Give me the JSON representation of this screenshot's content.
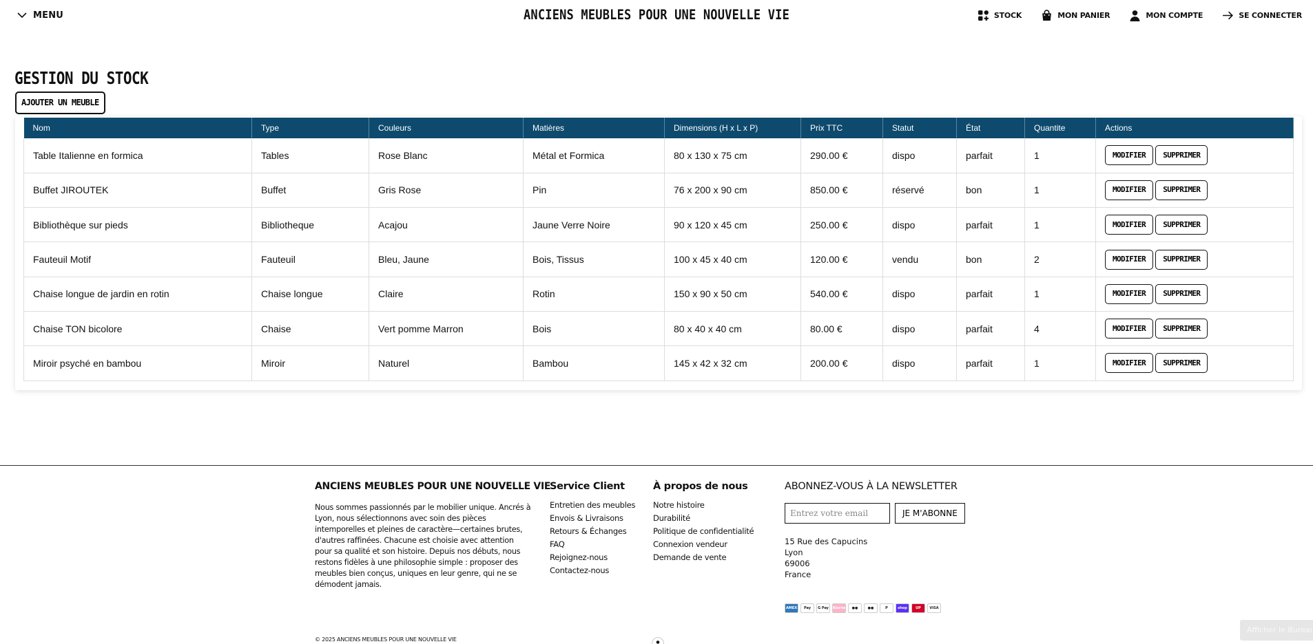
{
  "header": {
    "menu_label": "MENU",
    "site_title": "ANCIENS MEUBLES POUR UNE NOUVELLE VIE",
    "nav": {
      "stock": "STOCK",
      "cart": "MON PANIER",
      "account": "MON COMPTE",
      "login": "SE CONNECTER"
    }
  },
  "main": {
    "title": "GESTION DU STOCK",
    "add_button": "AJOUTER UN MEUBLE",
    "columns": [
      "Nom",
      "Type",
      "Couleurs",
      "Matières",
      "Dimensions (H x L x P)",
      "Prix TTC",
      "Statut",
      "État",
      "Quantite",
      "Actions"
    ],
    "rows": [
      {
        "nom": "Table Italienne en formica",
        "type": "Tables",
        "couleurs": "Rose  Blanc",
        "matieres": "Métal et Formica",
        "dimensions": "80 x 130 x 75 cm",
        "prix": "290.00 €",
        "statut": "dispo",
        "etat": "parfait",
        "quantite": "1"
      },
      {
        "nom": "Buffet JIROUTEK",
        "type": "Buffet",
        "couleurs": "Gris Rose",
        "matieres": "Pin",
        "dimensions": "76 x 200 x 90 cm",
        "prix": "850.00 €",
        "statut": "réservé",
        "etat": "bon",
        "quantite": "1"
      },
      {
        "nom": "Bibliothèque sur pieds",
        "type": "Bibliotheque",
        "couleurs": "Acajou",
        "matieres": "Jaune  Verre Noire",
        "dimensions": "90 x 120 x 45 cm",
        "prix": "250.00 €",
        "statut": "dispo",
        "etat": "parfait",
        "quantite": "1"
      },
      {
        "nom": "Fauteuil Motif",
        "type": "Fauteuil",
        "couleurs": "Bleu, Jaune",
        "matieres": "Bois, Tissus",
        "dimensions": "100 x 45 x 40 cm",
        "prix": "120.00 €",
        "statut": "vendu",
        "etat": "bon",
        "quantite": "2"
      },
      {
        "nom": "Chaise longue de jardin en rotin",
        "type": "Chaise longue",
        "couleurs": "Claire",
        "matieres": "Rotin",
        "dimensions": "150 x 90 x 50 cm",
        "prix": "540.00 €",
        "statut": "dispo",
        "etat": "parfait",
        "quantite": "1"
      },
      {
        "nom": "Chaise TON bicolore",
        "type": "Chaise",
        "couleurs": "Vert pomme Marron",
        "matieres": "Bois",
        "dimensions": "80 x 40 x 40 cm",
        "prix": "80.00 €",
        "statut": "dispo",
        "etat": "parfait",
        "quantite": "4"
      },
      {
        "nom": "Miroir psyché en bambou",
        "type": "Miroir",
        "couleurs": "Naturel",
        "matieres": "Bambou",
        "dimensions": "145 x 42 x 32 cm",
        "prix": "200.00 €",
        "statut": "dispo",
        "etat": "parfait",
        "quantite": "1"
      }
    ],
    "action_modify": "MODIFIER",
    "action_delete": "SUPPRIMER",
    "header_color": "#0e4a6d"
  },
  "footer": {
    "brand_title": "ANCIENS MEUBLES POUR UNE NOUVELLE VIE",
    "brand_text": "Nous sommes passionnés par le mobilier unique. Ancrés à Lyon, nous sélectionnons avec soin des pièces intemporelles et pleines de caractère—certaines brutes, d'autres raffinées. Chacune est choisie avec attention pour sa qualité et son histoire. Depuis nos débuts, nous restons fidèles à une philosophie simple : proposer des meubles bien conçus, uniques en leur genre, qui ne se démodent jamais.",
    "service_title": "Service Client",
    "service_links": [
      "Entretien des meubles",
      "Envois & Livraisons",
      "Retours & Échanges",
      "FAQ",
      "Rejoignez-nous",
      "Contactez-nous"
    ],
    "about_title": "À propos de nous",
    "about_links": [
      "Notre histoire",
      "Durabilité",
      "Politique de confidentialité",
      "Connexion vendeur",
      "Demande de vente"
    ],
    "newsletter_title": "ABONNEZ-VOUS À LA NEWSLETTER",
    "newsletter_placeholder": "Entrez votre email",
    "newsletter_button": "JE M'ABONNE",
    "address": [
      "15 Rue des Capucins",
      "Lyon",
      "69006",
      "France"
    ],
    "payments": [
      {
        "name": "amex-icon",
        "label": "AMEX",
        "color": "#2e77bc"
      },
      {
        "name": "apple-pay-icon",
        "label": "Pay",
        "color": "#ffffff"
      },
      {
        "name": "google-pay-icon",
        "label": "G Pay",
        "color": "#ffffff"
      },
      {
        "name": "klarna-icon",
        "label": "Klarna",
        "color": "#ffb3c7"
      },
      {
        "name": "maestro-icon",
        "label": "●●",
        "color": "#ffffff"
      },
      {
        "name": "mastercard-icon",
        "label": "●●",
        "color": "#ffffff"
      },
      {
        "name": "paypal-icon",
        "label": "P",
        "color": "#ffffff"
      },
      {
        "name": "shop-pay-icon",
        "label": "shop",
        "color": "#5a31f4"
      },
      {
        "name": "union-pay-icon",
        "label": "UP",
        "color": "#d10429"
      },
      {
        "name": "visa-icon",
        "label": "VISA",
        "color": "#ffffff"
      }
    ],
    "copyright": "© 2025 ANCIENS MEUBLES POUR UNE NOUVELLE VIE",
    "desktop_button": "Afficher le Bureau"
  }
}
